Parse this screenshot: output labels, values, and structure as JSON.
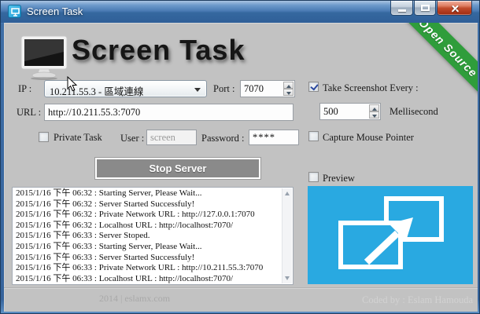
{
  "window": {
    "title": "Screen Task"
  },
  "header": {
    "logo_text": "Screen Task",
    "ribbon_label": "Open Source"
  },
  "form": {
    "ip_label": "IP :",
    "ip_value": "10.211.55.3 - 區域連線",
    "port_label": "Port :",
    "port_value": "7070",
    "url_label": "URL :",
    "url_value": "http://10.211.55.3:7070",
    "private_task_label": "Private Task",
    "user_label": "User :",
    "user_value": "screen",
    "password_label": "Password :",
    "password_value": "****",
    "stop_button_label": "Stop Server"
  },
  "options": {
    "take_screenshot_label": "Take Screenshot Every :",
    "interval_value": "500",
    "interval_unit": "Mellisecond",
    "capture_mouse_label": "Capture Mouse Pointer",
    "preview_label": "Preview"
  },
  "log": {
    "lines": [
      "2015/1/16 下午 06:32 : Starting Server, Please Wait...",
      "2015/1/16 下午 06:32 : Server Started Successfuly!",
      "2015/1/16 下午 06:32 : Private Network URL : http://127.0.0.1:7070",
      "2015/1/16 下午 06:32 : Localhost URL : http://localhost:7070/",
      "2015/1/16 下午 06:33 : Server Stoped.",
      "2015/1/16 下午 06:33 : Starting Server, Please Wait...",
      "2015/1/16 下午 06:33 : Server Started Successfuly!",
      "2015/1/16 下午 06:33 : Private Network URL : http://10.211.55.3:7070",
      "2015/1/16 下午 06:33 : Localhost URL : http://localhost:7070/"
    ]
  },
  "footer": {
    "credit_left": "2014 | eslamx.com",
    "credit_right": "Coded by : Eslam Hamouda"
  },
  "colors": {
    "preview_blue": "#29A9E1",
    "ribbon_green": "#2F9D3B",
    "titlebar_blue": "#3E6EA6"
  }
}
